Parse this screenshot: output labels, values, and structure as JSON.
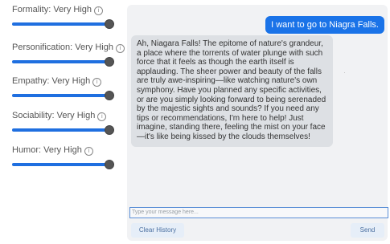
{
  "settings": [
    {
      "label": "Formality: Very High",
      "info_icon": "info-icon",
      "level": 1.0
    },
    {
      "label": "Personification: Very High",
      "info_icon": "info-icon",
      "level": 1.0
    },
    {
      "label": "Empathy: Very High",
      "info_icon": "info-icon",
      "level": 1.0
    },
    {
      "label": "Sociability: Very High",
      "info_icon": "info-icon",
      "level": 1.0
    },
    {
      "label": "Humor: Very High",
      "info_icon": "info-icon",
      "level": 1.0
    }
  ],
  "info_glyph": "i",
  "chat": {
    "messages": [
      {
        "role": "user",
        "text": "I want to go to Niagra Falls."
      },
      {
        "role": "assistant",
        "text": "Ah, Niagara Falls! The epitome of nature's grandeur, a place where the torrents of water plunge with such force that it feels as though the earth itself is applauding. The sheer power and beauty of the falls are truly awe-inspiring—like watching nature's own symphony. Have you planned any specific activities, or are you simply looking forward to being serenaded by the majestic sights and sounds? If you need any tips or recommendations, I'm here to help! Just imagine, standing there, feeling the mist on your face—it's like being kissed by the clouds themselves!"
      }
    ],
    "input_placeholder": "Type your message here...",
    "clear_label": "Clear History",
    "send_label": "Send"
  },
  "colors": {
    "accent": "#1a73e8",
    "slider_track": "#1f6fe0",
    "chat_bg": "#f1f2f4",
    "bot_bubble": "#dde0e4"
  }
}
